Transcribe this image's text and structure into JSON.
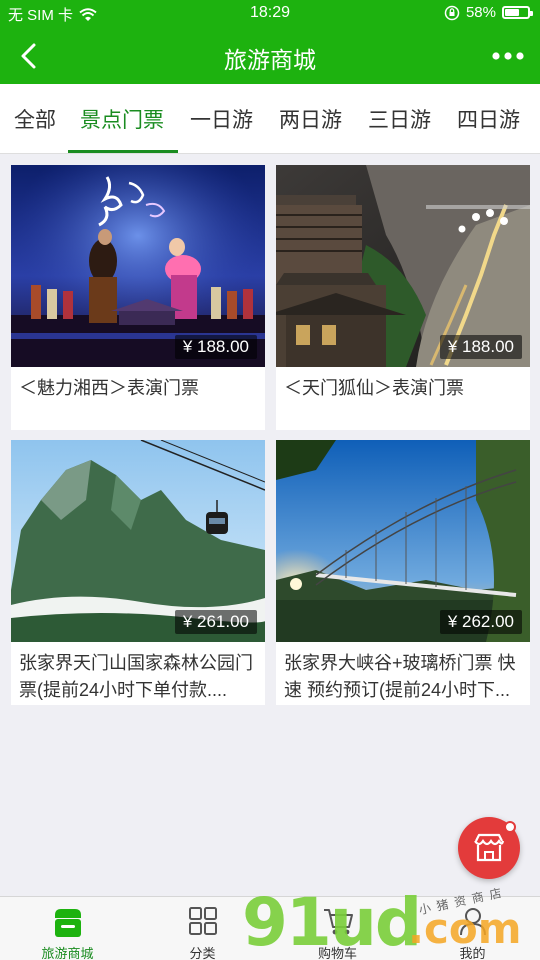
{
  "status_bar": {
    "carrier": "无 SIM 卡",
    "time": "18:29",
    "battery": "58%",
    "battery_level": 0.58
  },
  "nav": {
    "title": "旅游商城"
  },
  "tabs": [
    {
      "label": "全部"
    },
    {
      "label": "景点门票"
    },
    {
      "label": "一日游"
    },
    {
      "label": "两日游"
    },
    {
      "label": "三日游"
    },
    {
      "label": "四日游"
    }
  ],
  "active_tab": 1,
  "products": [
    {
      "price": "¥ 188.00",
      "title": "＜魅力湘西＞表演门票"
    },
    {
      "price": "¥ 188.00",
      "title": "＜天门狐仙＞表演门票"
    },
    {
      "price": "¥ 261.00",
      "title": "张家界天门山国家森林公园门票(提前24小时下单付款...."
    },
    {
      "price": "¥ 262.00",
      "title": "张家界大峡谷+玻璃桥门票 快速 预约预订(提前24小时下..."
    }
  ],
  "tab_bar": [
    {
      "label": "旅游商城",
      "icon": "store-icon"
    },
    {
      "label": "分类",
      "icon": "grid-icon"
    },
    {
      "label": "购物车",
      "icon": "cart-icon"
    },
    {
      "label": "我的",
      "icon": "user-icon"
    }
  ],
  "watermark": {
    "main": "91ud",
    "suffix": ".com",
    "slogan": "小猪资商店"
  },
  "colors": {
    "brand_green": "#1db20f",
    "active_tab": "#1a8c20",
    "fab_red": "#e33b3b"
  }
}
